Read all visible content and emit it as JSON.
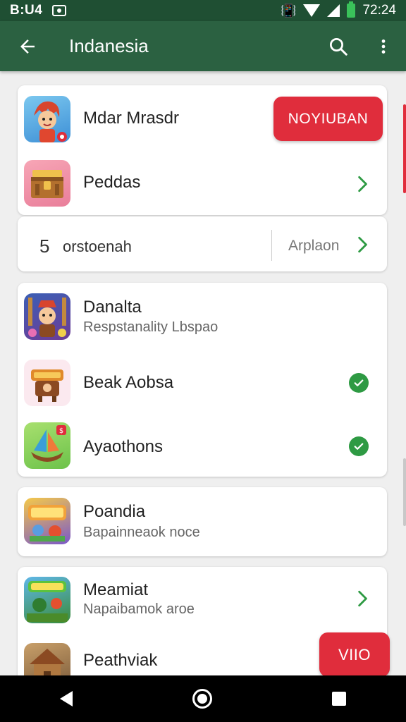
{
  "status_bar": {
    "time_left": "B:U4",
    "time_right": "72:24"
  },
  "app_bar": {
    "title": "Indanesia"
  },
  "top_card": {
    "featured_title": "Mdar Mrasdr",
    "install_label": "NOYIUBAN",
    "second_title": "Peddas"
  },
  "summary_row": {
    "count": "5",
    "label": "orstoenah",
    "link_label": "Arplaon"
  },
  "list_card": {
    "items": [
      {
        "title": "Danalta",
        "subtitle": "Respstanality Lbspao"
      },
      {
        "title": "Beak Aobsa"
      },
      {
        "title": "Ayaothons"
      }
    ]
  },
  "card_pandia": {
    "title": "Poandia",
    "subtitle": "Bapainneaok noce"
  },
  "card_bottom": {
    "items": [
      {
        "title": "Meamiat",
        "subtitle": "Napaibamok aroe"
      },
      {
        "title": "Peathviak"
      }
    ],
    "fab_label": "VIIO"
  },
  "colors": {
    "status_bar": "#1f4f33",
    "app_bar": "#2b6141",
    "accent_red": "#e02d3c",
    "accent_green": "#2e9a43"
  },
  "icons": [
    "back-arrow-icon",
    "search-icon",
    "more-vert-icon",
    "chevron-right-icon",
    "check-circle-icon"
  ]
}
